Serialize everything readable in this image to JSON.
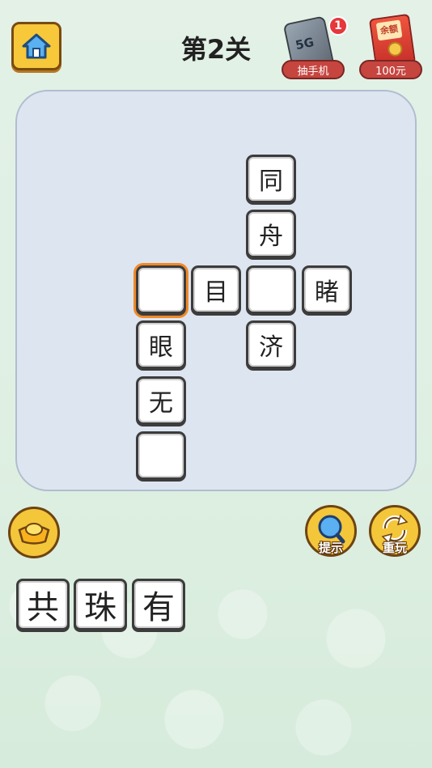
{
  "header": {
    "title": "第2关",
    "phone_promo": {
      "label": "抽手机",
      "badge": "1",
      "phone_text": "5G"
    },
    "balance_promo": {
      "label": "100元",
      "card_text": "余额"
    }
  },
  "board": {
    "cells": [
      {
        "id": "c1",
        "text": "同"
      },
      {
        "id": "c2",
        "text": "舟"
      },
      {
        "id": "c3",
        "text": "",
        "selected": true
      },
      {
        "id": "c4",
        "text": "目"
      },
      {
        "id": "c5",
        "text": ""
      },
      {
        "id": "c6",
        "text": "睹"
      },
      {
        "id": "c7",
        "text": "眼"
      },
      {
        "id": "c8",
        "text": "济"
      },
      {
        "id": "c9",
        "text": "无"
      },
      {
        "id": "c10",
        "text": ""
      }
    ]
  },
  "actions": {
    "hint_label": "提示",
    "replay_label": "重玩"
  },
  "choices": [
    "共",
    "珠",
    "有"
  ],
  "colors": {
    "accent_yellow": "#f4c63a",
    "selected_outline": "#f08a26",
    "promo_red": "#c6453f"
  }
}
